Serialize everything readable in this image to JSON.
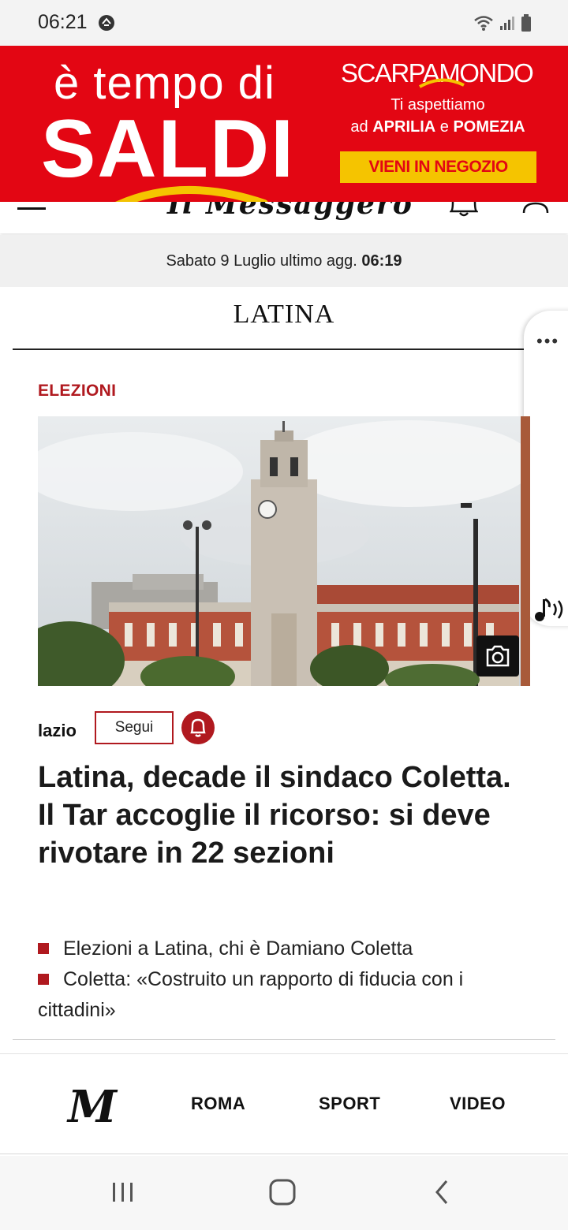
{
  "status_bar": {
    "time": "06:21"
  },
  "ad": {
    "line1": "è tempo di",
    "line2": "SALDI",
    "brand": "SCARPAMONDO",
    "sub1": "Ti aspettiamo",
    "sub2_pre": "ad ",
    "sub2_city1": "APRILIA",
    "sub2_mid": " e ",
    "sub2_city2": "POMEZIA",
    "cta": "VIENI IN NEGOZIO",
    "colors": {
      "background": "#e30613",
      "cta": "#f5c400",
      "swoosh": "#f5c400"
    }
  },
  "header": {
    "logo_text": "Il Messaggero"
  },
  "date_bar": {
    "text": "Sabato 9 Luglio ultimo agg.",
    "time": "06:19"
  },
  "section": {
    "title": "LATINA"
  },
  "article": {
    "kicker": "ELEZIONI",
    "tag": "lazio",
    "follow_label": "Segui",
    "headline": "Latina, decade il sindaco Coletta. Il Tar accoglie il ricorso: si deve rivotare in 22 sezioni",
    "related": [
      "Elezioni a Latina, chi è Damiano Coletta",
      "Coletta: «Costruito un rapporto di fiducia con i cittadini»"
    ],
    "accent_color": "#b0191f"
  },
  "side_tab": {
    "dots": "•••"
  },
  "bottom_nav": {
    "logo": "M",
    "items": [
      "ROMA",
      "SPORT",
      "VIDEO"
    ]
  }
}
